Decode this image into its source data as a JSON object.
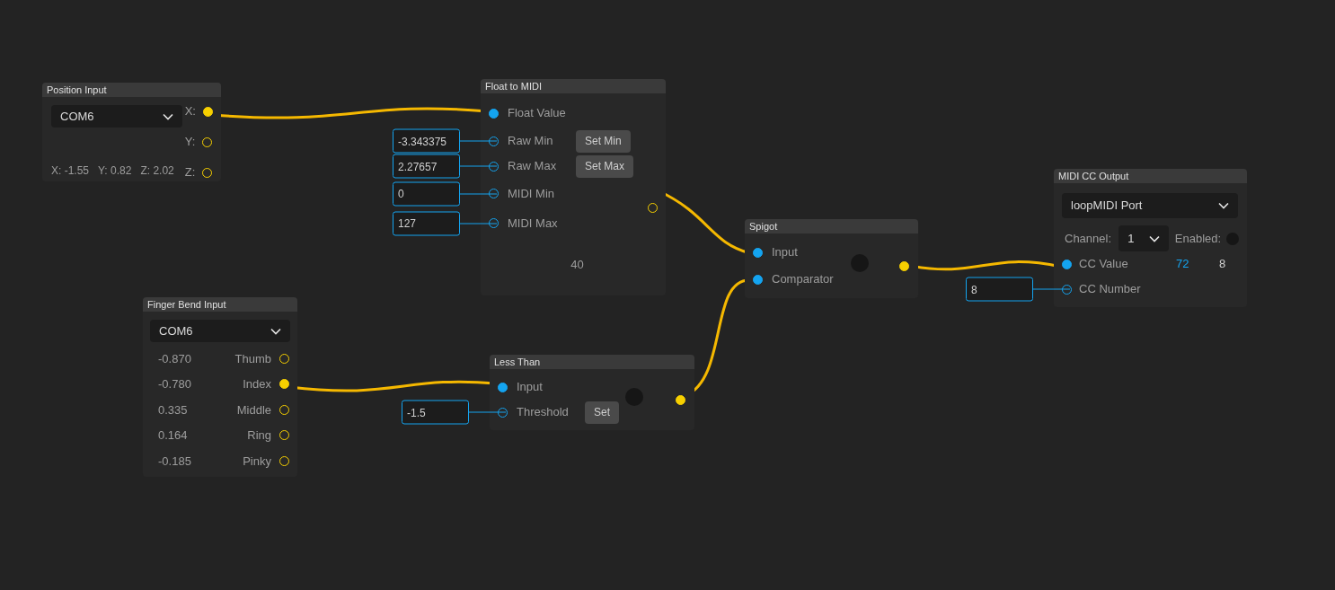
{
  "nodes": [
    {
      "kind": "position",
      "title": "Position Input",
      "port_select": "COM6",
      "outputs": [
        {
          "label": "X:",
          "connected": true
        },
        {
          "label": "Y:",
          "connected": false
        },
        {
          "label": "Z:",
          "connected": false
        }
      ],
      "readout": [
        "X: -1.55",
        "Y: 0.82",
        "Z: 2.02"
      ]
    },
    {
      "kind": "float_to_midi",
      "title": "Float to MIDI",
      "inputs": [
        {
          "label": "Float Value",
          "connected": true
        },
        {
          "label": "Raw Min",
          "connected": false,
          "value": "-3.343375",
          "button": "Set Min"
        },
        {
          "label": "Raw Max",
          "connected": false,
          "value": "2.27657",
          "button": "Set Max"
        },
        {
          "label": "MIDI Min",
          "connected": false,
          "value": "0"
        },
        {
          "label": "MIDI Max",
          "connected": false,
          "value": "127"
        }
      ],
      "output": {
        "connected": false
      },
      "result": "40"
    },
    {
      "kind": "spigot",
      "title": "Spigot",
      "inputs": [
        {
          "label": "Input",
          "connected": true
        },
        {
          "label": "Comparator",
          "connected": true
        }
      ],
      "indicator_on": false,
      "output": {
        "connected": true
      }
    },
    {
      "kind": "midi_out",
      "title": "MIDI CC Output",
      "port_select": "loopMIDI Port",
      "channel_label": "Channel:",
      "channel": "1",
      "enabled_label": "Enabled:",
      "enabled": false,
      "inputs": [
        {
          "label": "CC Value",
          "connected": true,
          "reading": "72",
          "color": "#14a4f0"
        },
        {
          "label": "CC Number",
          "connected": false,
          "value": "8",
          "reading": "8",
          "color": "#d0d0d0"
        }
      ]
    },
    {
      "kind": "finger",
      "title": "Finger Bend Input",
      "port_select": "COM6",
      "outputs": [
        {
          "reading": "-0.870",
          "label": "Thumb",
          "connected": false
        },
        {
          "reading": "-0.780",
          "label": "Index",
          "connected": true
        },
        {
          "reading": "0.335",
          "label": "Middle",
          "connected": false
        },
        {
          "reading": "0.164",
          "label": "Ring",
          "connected": false
        },
        {
          "reading": "-0.185",
          "label": "Pinky",
          "connected": false
        }
      ]
    },
    {
      "kind": "less_than",
      "title": "Less Than",
      "inputs": [
        {
          "label": "Input",
          "connected": true
        },
        {
          "label": "Threshold",
          "connected": false,
          "value": "-1.5",
          "button": "Set"
        }
      ],
      "indicator_on": false,
      "output": {
        "connected": true
      }
    }
  ]
}
